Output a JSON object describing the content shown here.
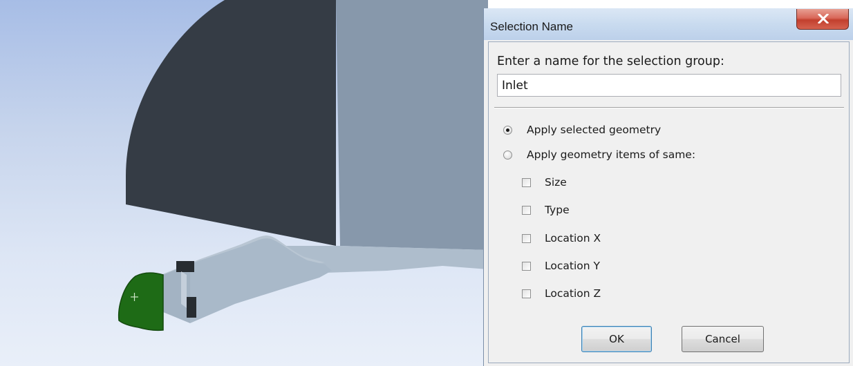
{
  "viewport": {
    "background_top": "#a7bde6",
    "background_bottom": "#e9eff9",
    "body_dark_face": "#353c45",
    "body_side_face": "#8798ab",
    "pipe_color": "#a9b9c9",
    "selected_face_color": "#1e6b16"
  },
  "dialog": {
    "title": "Selection Name",
    "close_icon": "close-x-icon",
    "prompt": "Enter a name for the selection group:",
    "name_value": "Inlet",
    "options": [
      {
        "label": "Apply selected geometry",
        "checked": true
      },
      {
        "label": "Apply geometry items of same:",
        "checked": false
      }
    ],
    "criteria": [
      {
        "label": "Size",
        "checked": false
      },
      {
        "label": "Type",
        "checked": false
      },
      {
        "label": "Location X",
        "checked": false
      },
      {
        "label": "Location Y",
        "checked": false
      },
      {
        "label": "Location Z",
        "checked": false
      }
    ],
    "ok_label": "OK",
    "cancel_label": "Cancel"
  }
}
